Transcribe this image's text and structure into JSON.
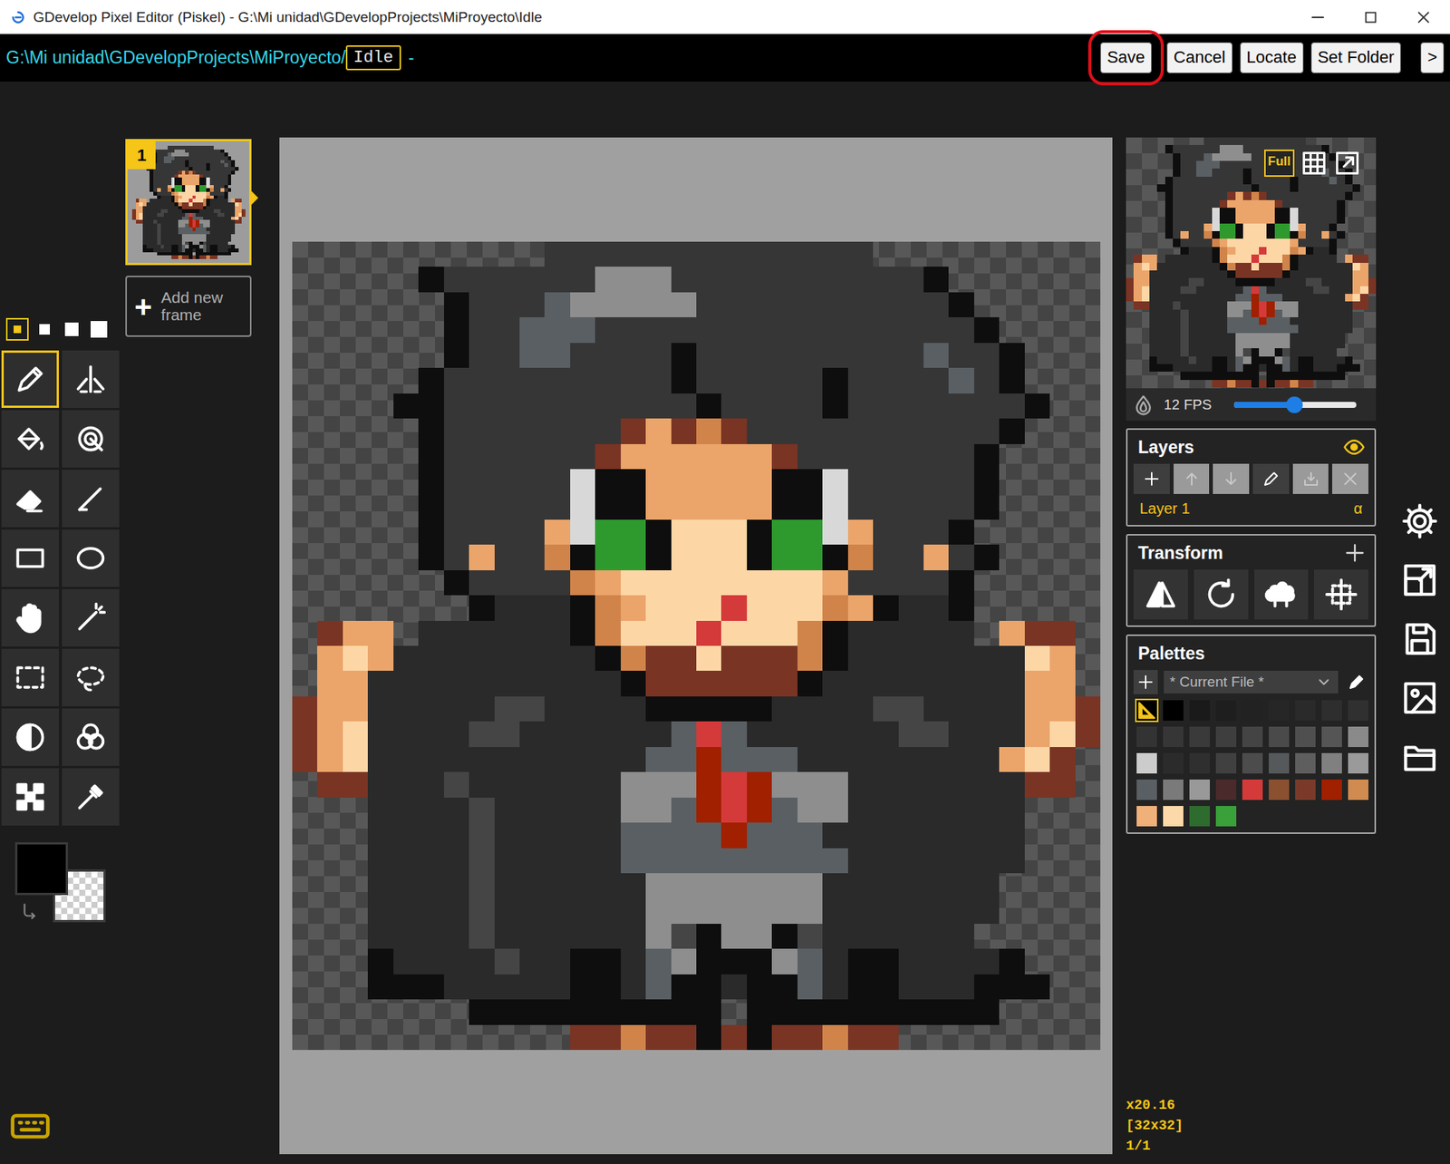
{
  "window": {
    "title": "GDevelop Pixel Editor (Piskel) - G:\\Mi unidad\\GDevelopProjects\\MiProyecto\\Idle"
  },
  "toolbar": {
    "path": "G:\\Mi unidad\\GDevelopProjects\\MiProyecto/",
    "name": "Idle",
    "suffix": "-",
    "buttons": [
      {
        "label": "Save",
        "highlighted": true
      },
      {
        "label": "Cancel",
        "highlighted": false
      },
      {
        "label": "Locate",
        "highlighted": false
      },
      {
        "label": "Set Folder",
        "highlighted": false
      },
      {
        "label": ">",
        "highlighted": false
      }
    ]
  },
  "frames": [
    {
      "number": "1",
      "selected": true
    }
  ],
  "add_frame": {
    "icon": "+",
    "label": "Add new frame"
  },
  "pen_sizes": [
    {
      "selected": true
    },
    {
      "selected": false
    },
    {
      "selected": false
    },
    {
      "selected": false
    }
  ],
  "tools": [
    {
      "selected": true
    },
    {
      "selected": false
    },
    {
      "selected": false
    },
    {
      "selected": false
    },
    {
      "selected": false
    },
    {
      "selected": false
    },
    {
      "selected": false
    },
    {
      "selected": false
    },
    {
      "selected": false
    },
    {
      "selected": false
    },
    {
      "selected": false
    },
    {
      "selected": false
    },
    {
      "selected": false
    },
    {
      "selected": false
    },
    {
      "selected": false
    },
    {
      "selected": false
    }
  ],
  "colors": {
    "primary": {
      "kind": "solid",
      "color": "#000000"
    },
    "secondary": {
      "kind": "transparent"
    }
  },
  "preview": {
    "full": {
      "label": "Full",
      "selected": true
    },
    "fps": "12 FPS",
    "fps_level": 0.49
  },
  "layers": {
    "title": "Layers",
    "visible": true,
    "buttons": [
      {
        "disabled": false
      },
      {
        "disabled": true
      },
      {
        "disabled": true
      },
      {
        "disabled": false
      },
      {
        "disabled": true
      },
      {
        "disabled": true
      }
    ],
    "items": [
      {
        "name": "Layer 1",
        "alpha": "α",
        "selected": true
      }
    ]
  },
  "transform": {
    "title": "Transform"
  },
  "palettes": {
    "title": "Palettes",
    "current": "* Current File *",
    "swatches": [
      {
        "kind": "transparent",
        "selected": true
      },
      {
        "kind": "swatch",
        "color": "#000000",
        "selected": false
      },
      {
        "kind": "swatch",
        "color": "#1a1a1a",
        "selected": false
      },
      {
        "kind": "swatch",
        "color": "#1e1e1e",
        "selected": false
      },
      {
        "kind": "swatch",
        "color": "#222222",
        "selected": false
      },
      {
        "kind": "swatch",
        "color": "#262626",
        "selected": false
      },
      {
        "kind": "swatch",
        "color": "#2a2a2a",
        "selected": false
      },
      {
        "kind": "swatch",
        "color": "#2e2e2e",
        "selected": false
      },
      {
        "kind": "swatch",
        "color": "#303030",
        "selected": false
      },
      {
        "kind": "swatch",
        "color": "#333333",
        "selected": false
      },
      {
        "kind": "swatch",
        "color": "#363636",
        "selected": false
      },
      {
        "kind": "swatch",
        "color": "#3a3a3a",
        "selected": false
      },
      {
        "kind": "swatch",
        "color": "#3e3e3e",
        "selected": false
      },
      {
        "kind": "swatch",
        "color": "#444444",
        "selected": false
      },
      {
        "kind": "swatch",
        "color": "#4a4a4a",
        "selected": false
      },
      {
        "kind": "swatch",
        "color": "#4f4f4f",
        "selected": false
      },
      {
        "kind": "swatch",
        "color": "#555555",
        "selected": false
      },
      {
        "kind": "swatch",
        "color": "#8a8a8a",
        "selected": false
      },
      {
        "kind": "swatch",
        "color": "#cccccc",
        "selected": false
      },
      {
        "kind": "swatch",
        "color": "#2b2b2b",
        "selected": false
      },
      {
        "kind": "swatch",
        "color": "#2f2f2f",
        "selected": false
      },
      {
        "kind": "swatch",
        "color": "#404040",
        "selected": false
      },
      {
        "kind": "swatch",
        "color": "#4c4c4c",
        "selected": false
      },
      {
        "kind": "swatch",
        "color": "#56595b",
        "selected": false
      },
      {
        "kind": "swatch",
        "color": "#5e5e5e",
        "selected": false
      },
      {
        "kind": "swatch",
        "color": "#808080",
        "selected": false
      },
      {
        "kind": "swatch",
        "color": "#9a9a9a",
        "selected": false
      },
      {
        "kind": "swatch",
        "color": "#5a5f63",
        "selected": false
      },
      {
        "kind": "swatch",
        "color": "#7a7a7a",
        "selected": false
      },
      {
        "kind": "swatch",
        "color": "#999999",
        "selected": false
      },
      {
        "kind": "swatch",
        "color": "#4a2a2a",
        "selected": false
      },
      {
        "kind": "swatch",
        "color": "#d43a3a",
        "selected": false
      },
      {
        "kind": "swatch",
        "color": "#8a5030",
        "selected": false
      },
      {
        "kind": "swatch",
        "color": "#7a3a2a",
        "selected": false
      },
      {
        "kind": "swatch",
        "color": "#a02000",
        "selected": false
      },
      {
        "kind": "swatch",
        "color": "#d08b50",
        "selected": false
      },
      {
        "kind": "swatch",
        "color": "#f0b07a",
        "selected": false
      },
      {
        "kind": "swatch",
        "color": "#fdd8a8",
        "selected": false
      },
      {
        "kind": "swatch",
        "color": "#2e6b2e",
        "selected": false
      },
      {
        "kind": "swatch",
        "color": "#3aa03a",
        "selected": false
      }
    ]
  },
  "status": {
    "zoom": "x20.16",
    "size": "[32x32]",
    "frame": "1/1"
  }
}
